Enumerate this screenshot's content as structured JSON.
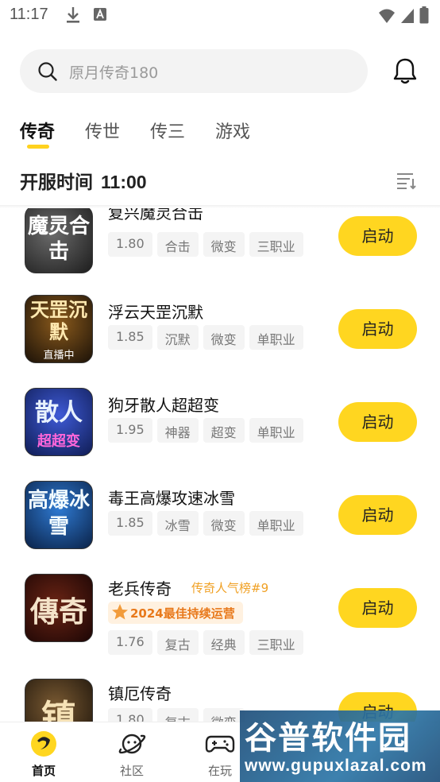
{
  "status_bar": {
    "time": "11:17"
  },
  "search": {
    "placeholder": "原月传奇180"
  },
  "tabs": [
    {
      "label": "传奇",
      "active": true
    },
    {
      "label": "传世",
      "active": false
    },
    {
      "label": "传三",
      "active": false
    },
    {
      "label": "游戏",
      "active": false
    }
  ],
  "server_time": {
    "label": "开服时间",
    "value": "11:00"
  },
  "games": [
    {
      "name": "复兴魔灵合击",
      "cover_text": "魔灵合击",
      "cover_color": "#2a2a2a",
      "tags": [
        "1.80",
        "合击",
        "微变",
        "三职业"
      ],
      "button": "启动"
    },
    {
      "name": "浮云天罡沉默",
      "cover_text": "天罡沉默",
      "cover_sub": "直播中",
      "cover_color": "#3a2a12",
      "tags": [
        "1.85",
        "沉默",
        "微变",
        "单职业"
      ],
      "button": "启动"
    },
    {
      "name": "狗牙散人超超变",
      "cover_text": "散人",
      "cover_sub": "超超变",
      "cover_color": "#1b2d6b",
      "tags": [
        "1.95",
        "神器",
        "超变",
        "单职业"
      ],
      "button": "启动"
    },
    {
      "name": "毒王高爆攻速冰雪",
      "cover_text": "高爆冰雪",
      "cover_color": "#0e3566",
      "tags": [
        "1.85",
        "冰雪",
        "微变",
        "单职业"
      ],
      "button": "启动"
    },
    {
      "name": "老兵传奇",
      "rank": "传奇人气榜#9",
      "badge": "2024最佳持续运营",
      "cover_text": "傳奇",
      "cover_color": "#2a0d08",
      "tags": [
        "1.76",
        "复古",
        "经典",
        "三职业"
      ],
      "button": "启动"
    },
    {
      "name": "镇厄传奇",
      "cover_text": "镇",
      "cover_color": "#231a10",
      "tags": [
        "1.80",
        "复古",
        "微变"
      ],
      "button": "启动"
    }
  ],
  "bottom_nav": [
    {
      "label": "首页",
      "icon": "home-icon",
      "active": true
    },
    {
      "label": "社区",
      "icon": "planet-icon",
      "active": false
    },
    {
      "label": "在玩",
      "icon": "gamepad-icon",
      "active": false
    }
  ],
  "watermark": {
    "title": "谷普软件园",
    "url": "www.gupuxlazal.com"
  },
  "colors": {
    "accent": "#ffd620",
    "badge_text": "#e8791b",
    "rank_text": "#f0a023"
  }
}
